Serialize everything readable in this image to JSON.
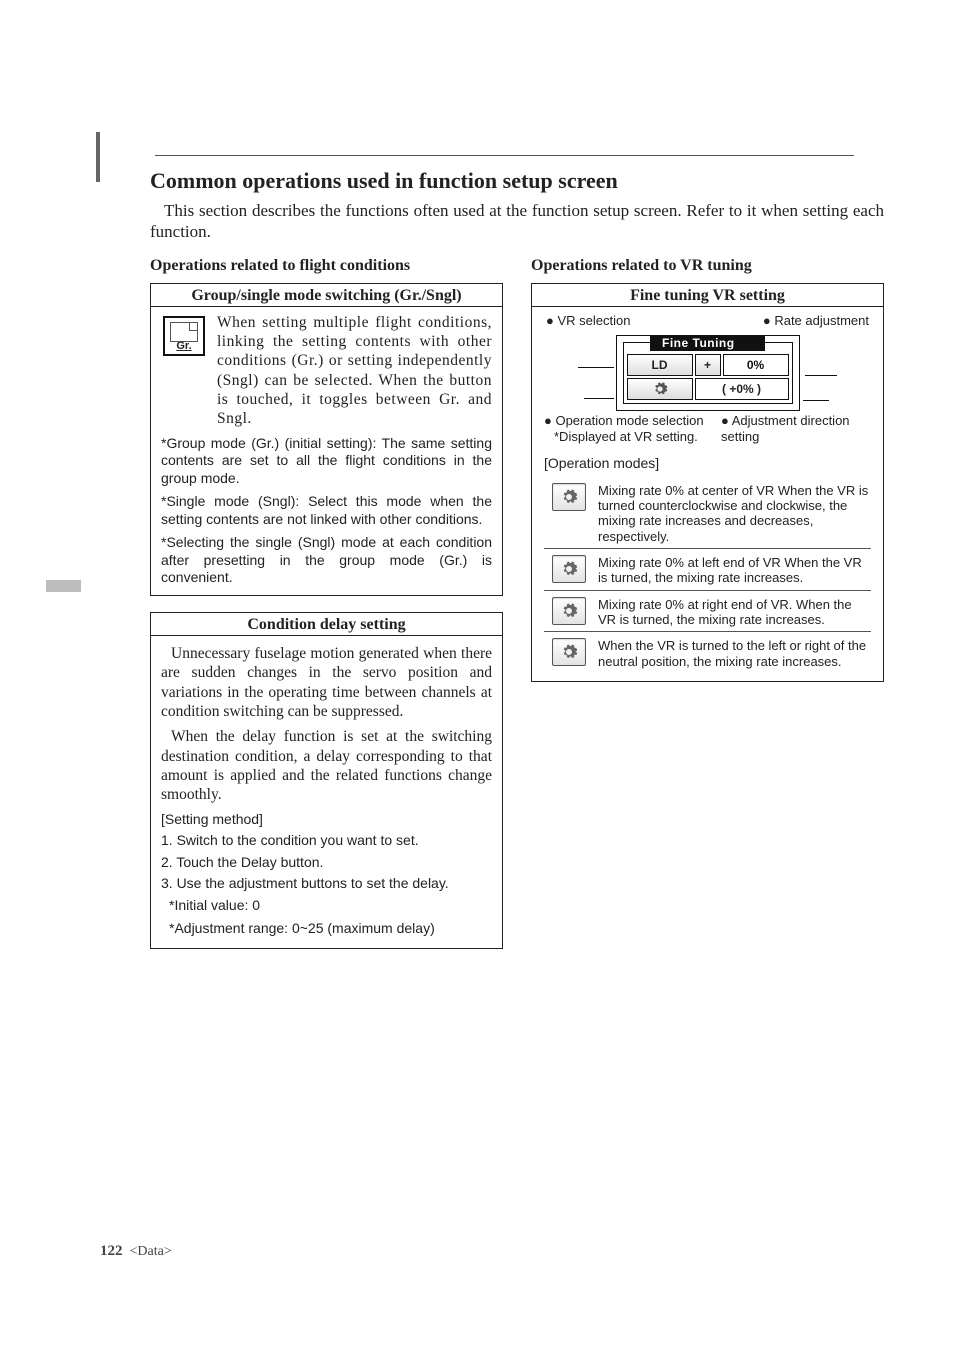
{
  "sectionTitle": "Common operations used in function setup screen",
  "intro": "This section describes the functions often used at the function setup screen. Refer to it when setting each function.",
  "left": {
    "heading": "Operations related to flight conditions",
    "box1": {
      "title": "Group/single mode switching (Gr./Sngl)",
      "icon_label": "Gr.",
      "body": "When setting multiple flight conditions, linking the setting contents with other conditions (Gr.) or setting independently (Sngl) can be selected. When the button is touched, it toggles between Gr. and Sngl.",
      "notes": [
        "*Group mode (Gr.) (initial setting): The same setting contents are set to all the flight conditions in the group mode.",
        "*Single mode (Sngl): Select this mode when the setting contents are not linked with other conditions.",
        "*Selecting the single (Sngl) mode at each condition after presetting in the group mode (Gr.) is convenient."
      ]
    },
    "box2": {
      "title": "Condition delay setting",
      "p1": "Unnecessary fuselage motion generated when there are sudden changes in the servo position and variations in the operating time between channels at condition switching can be suppressed.",
      "p2": "When the delay function is set at the switching destination condition, a delay corresponding to that amount is applied and the related functions change smoothly.",
      "setting_label": "[Setting method]",
      "steps": [
        "1. Switch to the condition you want to set.",
        "2. Touch the Delay button.",
        "3. Use the adjustment buttons to set the delay."
      ],
      "foot1": "*Initial value: 0",
      "foot2": "*Adjustment range: 0~25 (maximum delay)"
    }
  },
  "right": {
    "heading": "Operations related to VR tuning",
    "box": {
      "title": "Fine tuning VR setting",
      "label_vr": "● VR selection",
      "label_rate": "● Rate adjustment",
      "panel_title": "Fine Tuning",
      "ld": "LD",
      "plus": "+",
      "zero": "0%",
      "brace": "(  +0%  )",
      "label_opmode": "● Operation mode selection",
      "label_opmode_note": "*Displayed at VR setting.",
      "label_adjdir": "● Adjustment direction setting",
      "op_heading": "[Operation modes]",
      "ops": [
        "Mixing rate 0% at center of VR\nWhen the VR is turned counterclockwise and clockwise, the mixing rate increases and decreases, respectively.",
        "Mixing rate 0% at left end of VR\nWhen the VR is turned, the mixing rate increases.",
        "Mixing rate 0% at right end of VR.\nWhen the VR is turned, the mixing rate increases.",
        "When the VR is turned to the left or right of the neutral position, the mixing rate increases."
      ]
    }
  },
  "footer": {
    "page": "122",
    "label": "<Data>"
  }
}
